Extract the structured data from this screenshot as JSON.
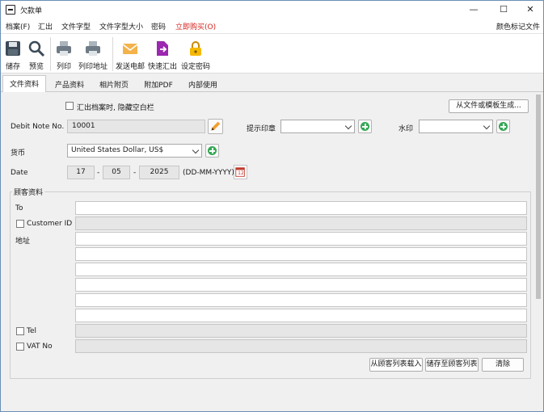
{
  "window": {
    "title": "欠款单",
    "minimize": "—",
    "maximize": "☐",
    "close": "✕"
  },
  "menu": {
    "items": [
      "档案(F)",
      "汇出",
      "文件字型",
      "文件字型大小",
      "密码",
      "立即购买(O)"
    ],
    "right": "颜色标记文件"
  },
  "toolbar": {
    "buttons": [
      {
        "label": "储存",
        "icon": "save-icon"
      },
      {
        "label": "预览",
        "icon": "magnifier-icon"
      },
      {
        "label": "列印",
        "icon": "printer-icon"
      },
      {
        "label": "列印地址",
        "icon": "printer-address-icon"
      },
      {
        "label": "发送电邮",
        "icon": "envelope-icon"
      },
      {
        "label": "快速汇出",
        "icon": "file-export-icon"
      },
      {
        "label": "设定密码",
        "icon": "lock-icon"
      }
    ]
  },
  "tabs": [
    "文件资料",
    "产品资料",
    "相片附页",
    "附加PDF",
    "内部使用"
  ],
  "form": {
    "hide_blank_label": "汇出档案时, 隐藏空白栏",
    "generate_button": "从文件或模板生成...",
    "debit_note_label": "Debit Note No.",
    "debit_note_value": "10001",
    "stamp_label": "提示印章",
    "stamp_value": "",
    "watermark_label": "水印",
    "watermark_value": "",
    "currency_label": "货币",
    "currency_value": "United States Dollar, US$",
    "date_label": "Date",
    "date_day": "17",
    "date_month": "05",
    "date_year": "2025",
    "date_sep": "-",
    "date_format": "(DD-MM-YYYY)",
    "calendar_day": "12"
  },
  "customer": {
    "group_title": "顾客资料",
    "to_label": "To",
    "to_value": "",
    "customer_id_label": "Customer ID",
    "customer_id_value": "",
    "address_label": "地址",
    "address_lines": [
      "",
      "",
      "",
      "",
      "",
      ""
    ],
    "tel_label": "Tel",
    "tel_value": "",
    "vat_label": "VAT No",
    "vat_value": "",
    "load_button": "从顾客列表载入",
    "save_button": "储存至顾客列表",
    "clear_button": "清除"
  },
  "colors": {
    "accent": "#0078d7",
    "red_menu": "#d6221d",
    "add_green": "#34a853",
    "pencil": "#f0a030",
    "lock": "#f5b800",
    "export_purple": "#9c27b0"
  }
}
